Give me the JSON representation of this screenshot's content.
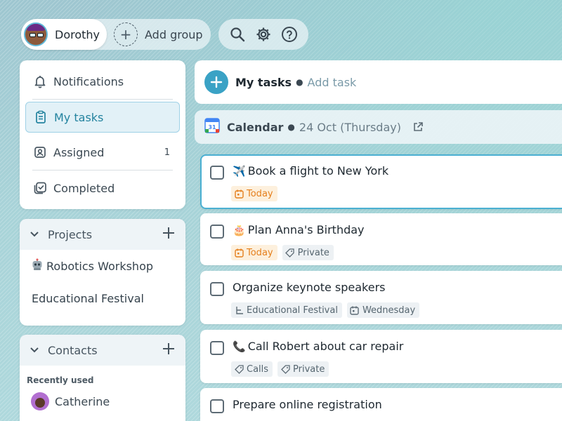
{
  "topbar": {
    "user_name": "Dorothy",
    "add_group_label": "Add group",
    "icons": [
      "search-icon",
      "gear-icon",
      "help-icon"
    ]
  },
  "nav": {
    "items": [
      {
        "label": "Notifications",
        "icon": "bell-icon"
      },
      {
        "label": "My tasks",
        "icon": "clipboard-icon",
        "active": true
      },
      {
        "label": "Assigned",
        "icon": "user-badge-icon",
        "count": "1"
      },
      {
        "label": "Completed",
        "icon": "check-stack-icon"
      }
    ]
  },
  "projects": {
    "title": "Projects",
    "items": [
      {
        "label": "Robotics Workshop",
        "icon": "robot-icon"
      },
      {
        "label": "Educational Festival"
      }
    ]
  },
  "contacts": {
    "title": "Contacts",
    "recent_label": "Recently used",
    "items": [
      {
        "label": "Catherine"
      }
    ]
  },
  "main": {
    "title": "My tasks",
    "add_task_placeholder": "Add task",
    "calendar": {
      "title": "Calendar",
      "date": "24 Oct (Thursday)",
      "icon_day": "31"
    },
    "tasks": [
      {
        "emoji": "✈️",
        "title": "Book a flight to New York",
        "tags": [
          {
            "label": "Today",
            "kind": "today"
          }
        ]
      },
      {
        "emoji": "🎂",
        "title": "Plan Anna's Birthday",
        "tags": [
          {
            "label": "Today",
            "kind": "today"
          },
          {
            "label": "Private",
            "kind": "tag"
          }
        ]
      },
      {
        "emoji": "",
        "title": "Organize keynote speakers",
        "tags": [
          {
            "label": "Educational Festival",
            "kind": "project"
          },
          {
            "label": "Wednesday",
            "kind": "date"
          }
        ]
      },
      {
        "emoji": "📞",
        "title": "Call Robert about car repair",
        "tags": [
          {
            "label": "Calls",
            "kind": "tag"
          },
          {
            "label": "Private",
            "kind": "tag"
          }
        ]
      },
      {
        "emoji": "",
        "title": "Prepare online registration",
        "tags": []
      }
    ]
  },
  "colors": {
    "accent": "#3aa2c5",
    "today": "#e57f1c",
    "today_bg": "#fdf0dd"
  }
}
